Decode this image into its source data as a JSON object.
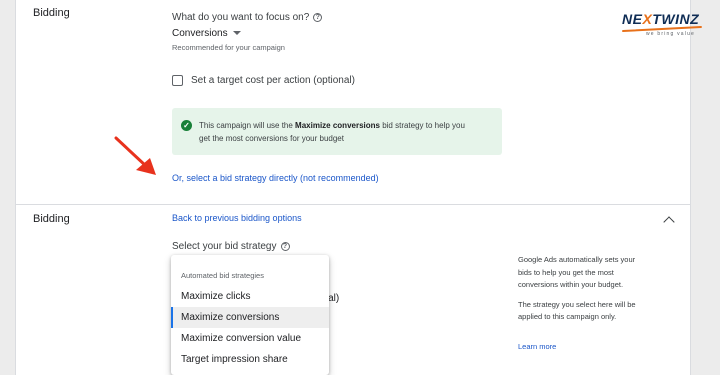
{
  "brand": {
    "logo_text_1": "NE",
    "logo_text_w": "X",
    "logo_text_2": "TWINZ",
    "tagline": "we bring value",
    "accent": "#e8711a",
    "navy": "#0f2d55"
  },
  "bidding_top": {
    "title": "Bidding",
    "focus_question": "What do you want to focus on?",
    "focus_value": "Conversions",
    "recommended": "Recommended for your campaign",
    "checkbox_label": "Set a target cost per action (optional)",
    "info_prefix": "This campaign will use the ",
    "info_strategy": "Maximize conversions",
    "info_line1_suffix": " bid strategy to help you",
    "info_line2": "get the most conversions for your budget",
    "direct_link": "Or, select a bid strategy directly (not recommended)"
  },
  "bidding_bottom": {
    "title": "Bidding",
    "back_link": "Back to previous bidding options",
    "select_label": "Select your bid strategy",
    "menu": {
      "header": "Automated bid strategies",
      "items": [
        {
          "label": "Maximize clicks",
          "selected": false
        },
        {
          "label": "Maximize conversions",
          "selected": true
        },
        {
          "label": "Maximize conversion value",
          "selected": false
        },
        {
          "label": "Target impression share",
          "selected": false
        }
      ]
    },
    "obscured_text": "onal)",
    "side_lines": [
      "Google Ads automatically sets your",
      "bids to help you get the most",
      "conversions within your budget."
    ],
    "side_lines_2": [
      "The strategy you select here will be",
      "applied to this campaign only."
    ],
    "learn_more": "Learn more"
  },
  "icons": {
    "help": "help-circle-icon",
    "check": "check-circle-icon",
    "caret": "caret-down-icon",
    "collapse": "chevron-up-icon",
    "arrow": "red-arrow-icon"
  },
  "colors": {
    "link": "#1a56c9",
    "success_bg": "#e6f4ea",
    "success_icon": "#188038",
    "arrow": "#e8321d",
    "selected_bar": "#1a73e8"
  }
}
